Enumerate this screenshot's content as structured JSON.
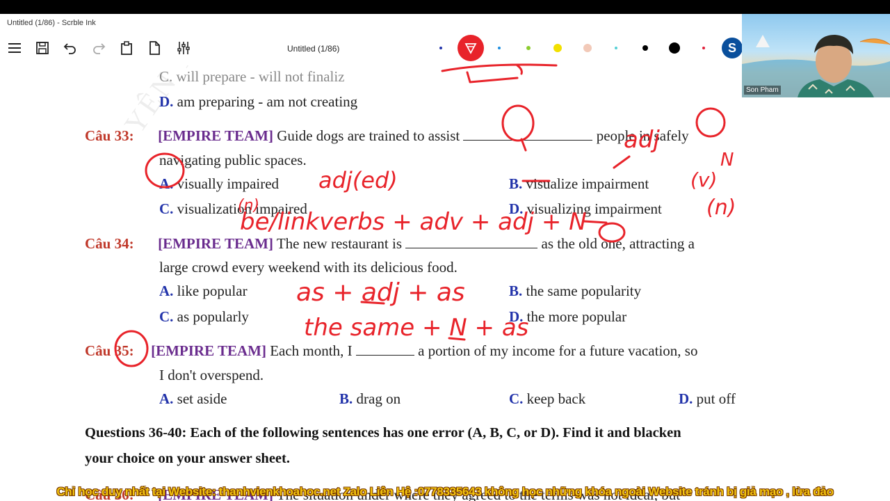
{
  "window": {
    "title": "Untitled (1/86) - Scrble Ink"
  },
  "toolbar": {
    "doc_title": "Untitled (1/86)",
    "active_color": "#e8232a",
    "palette": [
      "#2233aa",
      "#1e8fe0",
      "#8ccc2e",
      "#f2e000",
      "#f2c9b8",
      "#55d0d6",
      "#000000",
      "#000000",
      "#e0203a"
    ]
  },
  "webcam": {
    "name": "Son Pham"
  },
  "doc": {
    "prev_c": "C. will prepare - will not finaliz",
    "prev_d_letter": "D.",
    "prev_d_text": "am preparing - am not creating",
    "q33": {
      "num": "Câu 33:",
      "team": "[EMPIRE TEAM]",
      "text1": "Guide dogs are trained to assist",
      "text2": "people in safely",
      "text3": "navigating public spaces.",
      "a_letter": "A.",
      "a": "visually impaired",
      "b_letter": "B.",
      "b": "visualize impairment",
      "c_letter": "C.",
      "c": "visualization impaired",
      "d_letter": "D.",
      "d": "visualizing impairment"
    },
    "q34": {
      "num": "Câu 34:",
      "team": "[EMPIRE TEAM]",
      "text1": "The new restaurant is",
      "text2": "as the old one, attracting a",
      "text3": "large crowd every weekend with its delicious food.",
      "a_letter": "A.",
      "a": "like popular",
      "b_letter": "B.",
      "b": "the same popularity",
      "c_letter": "C.",
      "c": "as popularly",
      "d_letter": "D.",
      "d": "the more popular"
    },
    "q35": {
      "num": "Câu 35:",
      "team": "[EMPIRE TEAM]",
      "text1": "Each month, I",
      "text2": "a portion of my income for a future vacation, so",
      "text3": "I don't overspend.",
      "a_letter": "A.",
      "a": "set aside",
      "b_letter": "B.",
      "b": "drag on",
      "c_letter": "C.",
      "c": "keep back",
      "d_letter": "D.",
      "d": "put off"
    },
    "section": {
      "line1": "Questions 36-40: Each of the following sentences has one error (A, B, C, or D). Find it and blacken",
      "line2": "your choice on your answer sheet."
    },
    "q36": {
      "num": "Câu 36:",
      "team": "[EMPIRE TEAM]",
      "text1": "The situation under where they agreed to the terms was not ideal, but"
    },
    "watermark": "YÊN THI PHẠM QUANG LỤC"
  },
  "annotations": {
    "ink1": "adj",
    "ink2": "adj(ed)",
    "ink3": "(v)",
    "ink4": "N",
    "ink5": "(n)",
    "ink6": "(n)",
    "ink7": "be/linkverbs + adv + adj + N",
    "ink8": "as + adj + as",
    "ink9": "the same + N + as"
  },
  "banner": {
    "text": "Chỉ học duy nhất tại Website: thanhvienkhoahoc.net Zalo Liên Hệ :0778335643 không học những khóa ngoài Website tránh bị giả mạo , lừa đảo"
  }
}
